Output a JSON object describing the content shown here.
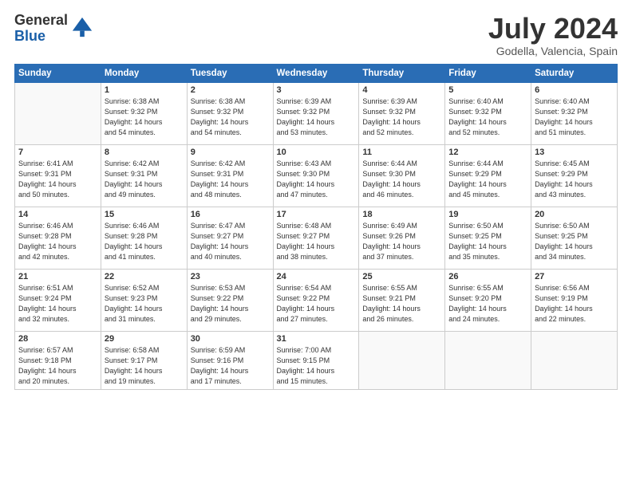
{
  "logo": {
    "general": "General",
    "blue": "Blue"
  },
  "header": {
    "month": "July 2024",
    "location": "Godella, Valencia, Spain"
  },
  "weekdays": [
    "Sunday",
    "Monday",
    "Tuesday",
    "Wednesday",
    "Thursday",
    "Friday",
    "Saturday"
  ],
  "weeks": [
    [
      {
        "day": "",
        "sunrise": "",
        "sunset": "",
        "daylight": ""
      },
      {
        "day": "1",
        "sunrise": "Sunrise: 6:38 AM",
        "sunset": "Sunset: 9:32 PM",
        "daylight": "Daylight: 14 hours and 54 minutes."
      },
      {
        "day": "2",
        "sunrise": "Sunrise: 6:38 AM",
        "sunset": "Sunset: 9:32 PM",
        "daylight": "Daylight: 14 hours and 54 minutes."
      },
      {
        "day": "3",
        "sunrise": "Sunrise: 6:39 AM",
        "sunset": "Sunset: 9:32 PM",
        "daylight": "Daylight: 14 hours and 53 minutes."
      },
      {
        "day": "4",
        "sunrise": "Sunrise: 6:39 AM",
        "sunset": "Sunset: 9:32 PM",
        "daylight": "Daylight: 14 hours and 52 minutes."
      },
      {
        "day": "5",
        "sunrise": "Sunrise: 6:40 AM",
        "sunset": "Sunset: 9:32 PM",
        "daylight": "Daylight: 14 hours and 52 minutes."
      },
      {
        "day": "6",
        "sunrise": "Sunrise: 6:40 AM",
        "sunset": "Sunset: 9:32 PM",
        "daylight": "Daylight: 14 hours and 51 minutes."
      }
    ],
    [
      {
        "day": "7",
        "sunrise": "Sunrise: 6:41 AM",
        "sunset": "Sunset: 9:31 PM",
        "daylight": "Daylight: 14 hours and 50 minutes."
      },
      {
        "day": "8",
        "sunrise": "Sunrise: 6:42 AM",
        "sunset": "Sunset: 9:31 PM",
        "daylight": "Daylight: 14 hours and 49 minutes."
      },
      {
        "day": "9",
        "sunrise": "Sunrise: 6:42 AM",
        "sunset": "Sunset: 9:31 PM",
        "daylight": "Daylight: 14 hours and 48 minutes."
      },
      {
        "day": "10",
        "sunrise": "Sunrise: 6:43 AM",
        "sunset": "Sunset: 9:30 PM",
        "daylight": "Daylight: 14 hours and 47 minutes."
      },
      {
        "day": "11",
        "sunrise": "Sunrise: 6:44 AM",
        "sunset": "Sunset: 9:30 PM",
        "daylight": "Daylight: 14 hours and 46 minutes."
      },
      {
        "day": "12",
        "sunrise": "Sunrise: 6:44 AM",
        "sunset": "Sunset: 9:29 PM",
        "daylight": "Daylight: 14 hours and 45 minutes."
      },
      {
        "day": "13",
        "sunrise": "Sunrise: 6:45 AM",
        "sunset": "Sunset: 9:29 PM",
        "daylight": "Daylight: 14 hours and 43 minutes."
      }
    ],
    [
      {
        "day": "14",
        "sunrise": "Sunrise: 6:46 AM",
        "sunset": "Sunset: 9:28 PM",
        "daylight": "Daylight: 14 hours and 42 minutes."
      },
      {
        "day": "15",
        "sunrise": "Sunrise: 6:46 AM",
        "sunset": "Sunset: 9:28 PM",
        "daylight": "Daylight: 14 hours and 41 minutes."
      },
      {
        "day": "16",
        "sunrise": "Sunrise: 6:47 AM",
        "sunset": "Sunset: 9:27 PM",
        "daylight": "Daylight: 14 hours and 40 minutes."
      },
      {
        "day": "17",
        "sunrise": "Sunrise: 6:48 AM",
        "sunset": "Sunset: 9:27 PM",
        "daylight": "Daylight: 14 hours and 38 minutes."
      },
      {
        "day": "18",
        "sunrise": "Sunrise: 6:49 AM",
        "sunset": "Sunset: 9:26 PM",
        "daylight": "Daylight: 14 hours and 37 minutes."
      },
      {
        "day": "19",
        "sunrise": "Sunrise: 6:50 AM",
        "sunset": "Sunset: 9:25 PM",
        "daylight": "Daylight: 14 hours and 35 minutes."
      },
      {
        "day": "20",
        "sunrise": "Sunrise: 6:50 AM",
        "sunset": "Sunset: 9:25 PM",
        "daylight": "Daylight: 14 hours and 34 minutes."
      }
    ],
    [
      {
        "day": "21",
        "sunrise": "Sunrise: 6:51 AM",
        "sunset": "Sunset: 9:24 PM",
        "daylight": "Daylight: 14 hours and 32 minutes."
      },
      {
        "day": "22",
        "sunrise": "Sunrise: 6:52 AM",
        "sunset": "Sunset: 9:23 PM",
        "daylight": "Daylight: 14 hours and 31 minutes."
      },
      {
        "day": "23",
        "sunrise": "Sunrise: 6:53 AM",
        "sunset": "Sunset: 9:22 PM",
        "daylight": "Daylight: 14 hours and 29 minutes."
      },
      {
        "day": "24",
        "sunrise": "Sunrise: 6:54 AM",
        "sunset": "Sunset: 9:22 PM",
        "daylight": "Daylight: 14 hours and 27 minutes."
      },
      {
        "day": "25",
        "sunrise": "Sunrise: 6:55 AM",
        "sunset": "Sunset: 9:21 PM",
        "daylight": "Daylight: 14 hours and 26 minutes."
      },
      {
        "day": "26",
        "sunrise": "Sunrise: 6:55 AM",
        "sunset": "Sunset: 9:20 PM",
        "daylight": "Daylight: 14 hours and 24 minutes."
      },
      {
        "day": "27",
        "sunrise": "Sunrise: 6:56 AM",
        "sunset": "Sunset: 9:19 PM",
        "daylight": "Daylight: 14 hours and 22 minutes."
      }
    ],
    [
      {
        "day": "28",
        "sunrise": "Sunrise: 6:57 AM",
        "sunset": "Sunset: 9:18 PM",
        "daylight": "Daylight: 14 hours and 20 minutes."
      },
      {
        "day": "29",
        "sunrise": "Sunrise: 6:58 AM",
        "sunset": "Sunset: 9:17 PM",
        "daylight": "Daylight: 14 hours and 19 minutes."
      },
      {
        "day": "30",
        "sunrise": "Sunrise: 6:59 AM",
        "sunset": "Sunset: 9:16 PM",
        "daylight": "Daylight: 14 hours and 17 minutes."
      },
      {
        "day": "31",
        "sunrise": "Sunrise: 7:00 AM",
        "sunset": "Sunset: 9:15 PM",
        "daylight": "Daylight: 14 hours and 15 minutes."
      },
      {
        "day": "",
        "sunrise": "",
        "sunset": "",
        "daylight": ""
      },
      {
        "day": "",
        "sunrise": "",
        "sunset": "",
        "daylight": ""
      },
      {
        "day": "",
        "sunrise": "",
        "sunset": "",
        "daylight": ""
      }
    ]
  ]
}
